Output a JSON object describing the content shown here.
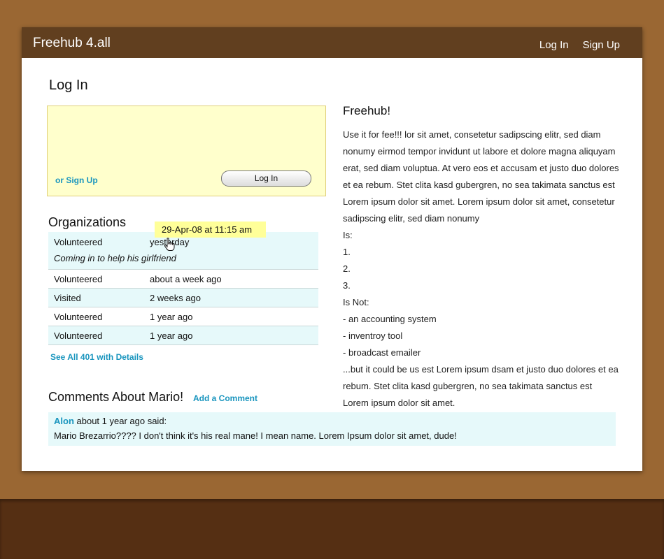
{
  "app": {
    "title": "Freehub 4.all"
  },
  "nav": {
    "login": "Log In",
    "signup": "Sign Up"
  },
  "login": {
    "heading": "Log In",
    "or_signup": "or Sign Up",
    "button": "Log In"
  },
  "organizations": {
    "heading": "Organizations",
    "tooltip": "29-Apr-08  at 11:15 am",
    "rows": [
      {
        "action": "Volunteered",
        "when": "yesterday",
        "note": "Coming in to help his girlfriend"
      },
      {
        "action": "Volunteered",
        "when": "about a week ago"
      },
      {
        "action": "Visited",
        "when": "2 weeks ago"
      },
      {
        "action": "Volunteered",
        "when": "1 year ago"
      },
      {
        "action": "Volunteered",
        "when": "1 year ago"
      }
    ],
    "see_all": "See All 401 with Details"
  },
  "comments": {
    "heading": "Comments About Mario!",
    "add_link": "Add a Comment",
    "items": [
      {
        "author": "Alon",
        "meta": "about 1 year ago said:",
        "text": "Mario Brezarrio???? I don't think it's his real mane! I mean name. Lorem Ipsum dolor sit amet, dude!"
      }
    ]
  },
  "about": {
    "heading": "Freehub!",
    "intro": "Use it for fee!!! lor sit amet, consetetur sadipscing elitr, sed diam nonumy eirmod tempor invidunt ut labore et dolore magna aliquyam erat, sed diam voluptua. At vero eos et accusam et justo duo dolores et ea rebum. Stet clita kasd gubergren, no sea takimata sanctus est Lorem ipsum dolor sit amet. Lorem ipsum dolor sit amet, consetetur sadipscing elitr, sed diam nonumy",
    "is_label": "Is:",
    "is_items": [
      "1.",
      "2.",
      "3."
    ],
    "is_not_label": "Is Not:",
    "is_not_items": [
      "- an accounting system",
      "- inventroy tool",
      "- broadcast emailer"
    ],
    "closing": "...but it could be us est Lorem ipsum dsam et justo duo dolores et ea rebum. Stet clita kasd gubergren, no sea takimata sanctus est Lorem ipsum dolor sit amet."
  },
  "colors": {
    "page_bg": "#9a6733",
    "topbar": "#613f1f",
    "footer": "#552f13",
    "link": "#1995be",
    "login_panel": "#ffffcc",
    "row_alt": "#e6f9fa",
    "tooltip": "#ffff99"
  },
  "icons": {
    "cursor": "hand-pointer-icon"
  }
}
